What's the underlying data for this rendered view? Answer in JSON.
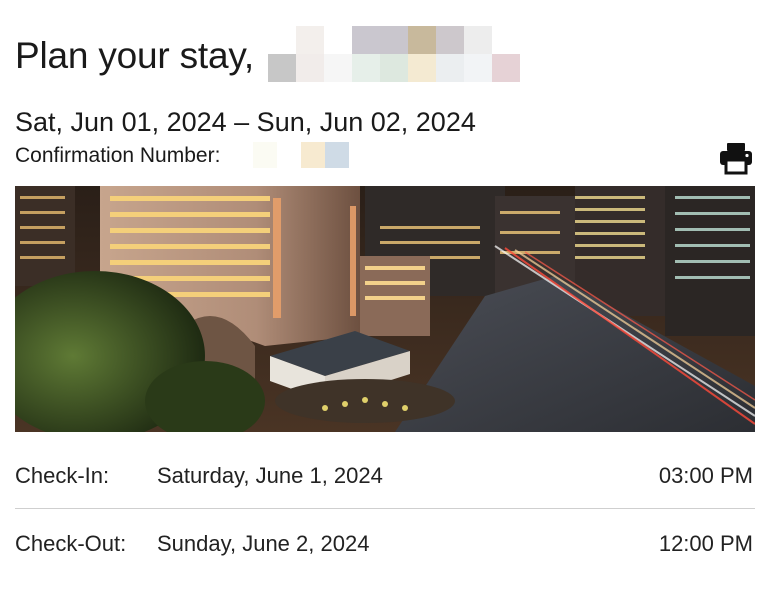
{
  "header": {
    "title": "Plan your stay,"
  },
  "stay": {
    "date_range": "Sat, Jun 01, 2024 – Sun, Jun 02, 2024",
    "confirmation_label": "Confirmation Number:"
  },
  "actions": {
    "print_icon": "printer-icon"
  },
  "hero_image": {
    "subject": "hotel-at-night-photo"
  },
  "check_in": {
    "label": "Check-In:",
    "date": "Saturday, June 1, 2024",
    "time": "03:00 PM"
  },
  "check_out": {
    "label": "Check-Out:",
    "date": "Sunday, June 2, 2024",
    "time": "12:00 PM"
  },
  "colors": {
    "text": "#1a1a1a",
    "divider": "#cfcfcf",
    "redaction_palette": [
      "#ececec",
      "#f4efea",
      "#c9c7cf",
      "#c9bb9e",
      "#dfdadb",
      "#e8f1ec",
      "#f4ead2",
      "#e4d6d9",
      "#cfdbe6"
    ]
  }
}
